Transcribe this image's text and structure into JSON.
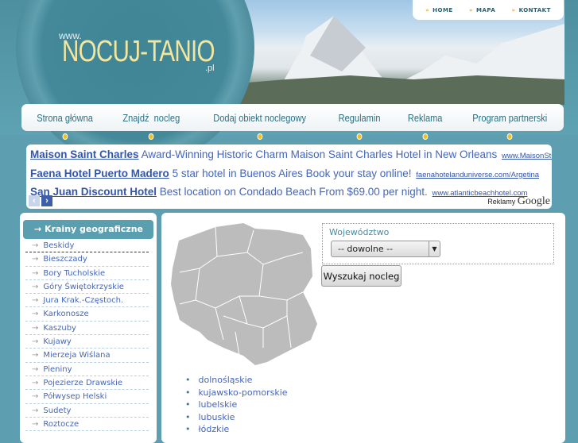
{
  "header": {
    "logo_www": "www.",
    "logo_main": "NOCUJ-TANIO",
    "logo_tld": ".pl",
    "top_links": [
      "HOME",
      "MAPA",
      "KONTAKT"
    ]
  },
  "nav": [
    "Strona główna",
    "Znajdź  nocleg",
    "Dodaj obiekt noclegowy",
    "Regulamin",
    "Reklama",
    "Program partnerski"
  ],
  "ads": {
    "items": [
      {
        "title": "Maison Saint Charles",
        "text": "Award-Winning Historic Charm Maison Saint Charles Hotel in New Orleans",
        "url": "www.MaisonStCharles"
      },
      {
        "title": "Faena Hotel Puerto Madero",
        "text": "5 star hotel in Buenos Aires Book your stay online!",
        "url": "faenahotelanduniverse.com/Argetina"
      },
      {
        "title": "San Juan Discount Hotel",
        "text": "Best location on Condado Beach From $69.00 per night.",
        "url": "www.atlanticbeachhotel.com"
      }
    ],
    "reklamy": "Reklamy",
    "google": "Google"
  },
  "sidebar": {
    "heading": "Krainy geograficzne",
    "items": [
      "Beskidy",
      "Bieszczady",
      "Bory Tucholskie",
      "Góry Świętokrzyskie",
      "Jura Krak.-Częstoch.",
      "Karkonosze",
      "Kaszuby",
      "Kujawy",
      "Mierzeja Wiślana",
      "Pieniny",
      "Pojezierze Drawskie",
      "Półwysep Helski",
      "Sudety",
      "Roztocze"
    ]
  },
  "search": {
    "label": "Województwo",
    "selected": "-- dowolne --",
    "button": "Wyszukaj nocleg"
  },
  "regions": [
    "dolnośląskie",
    "kujawsko-pomorskie",
    "lubelskie",
    "lubuskie",
    "łódzkie"
  ]
}
